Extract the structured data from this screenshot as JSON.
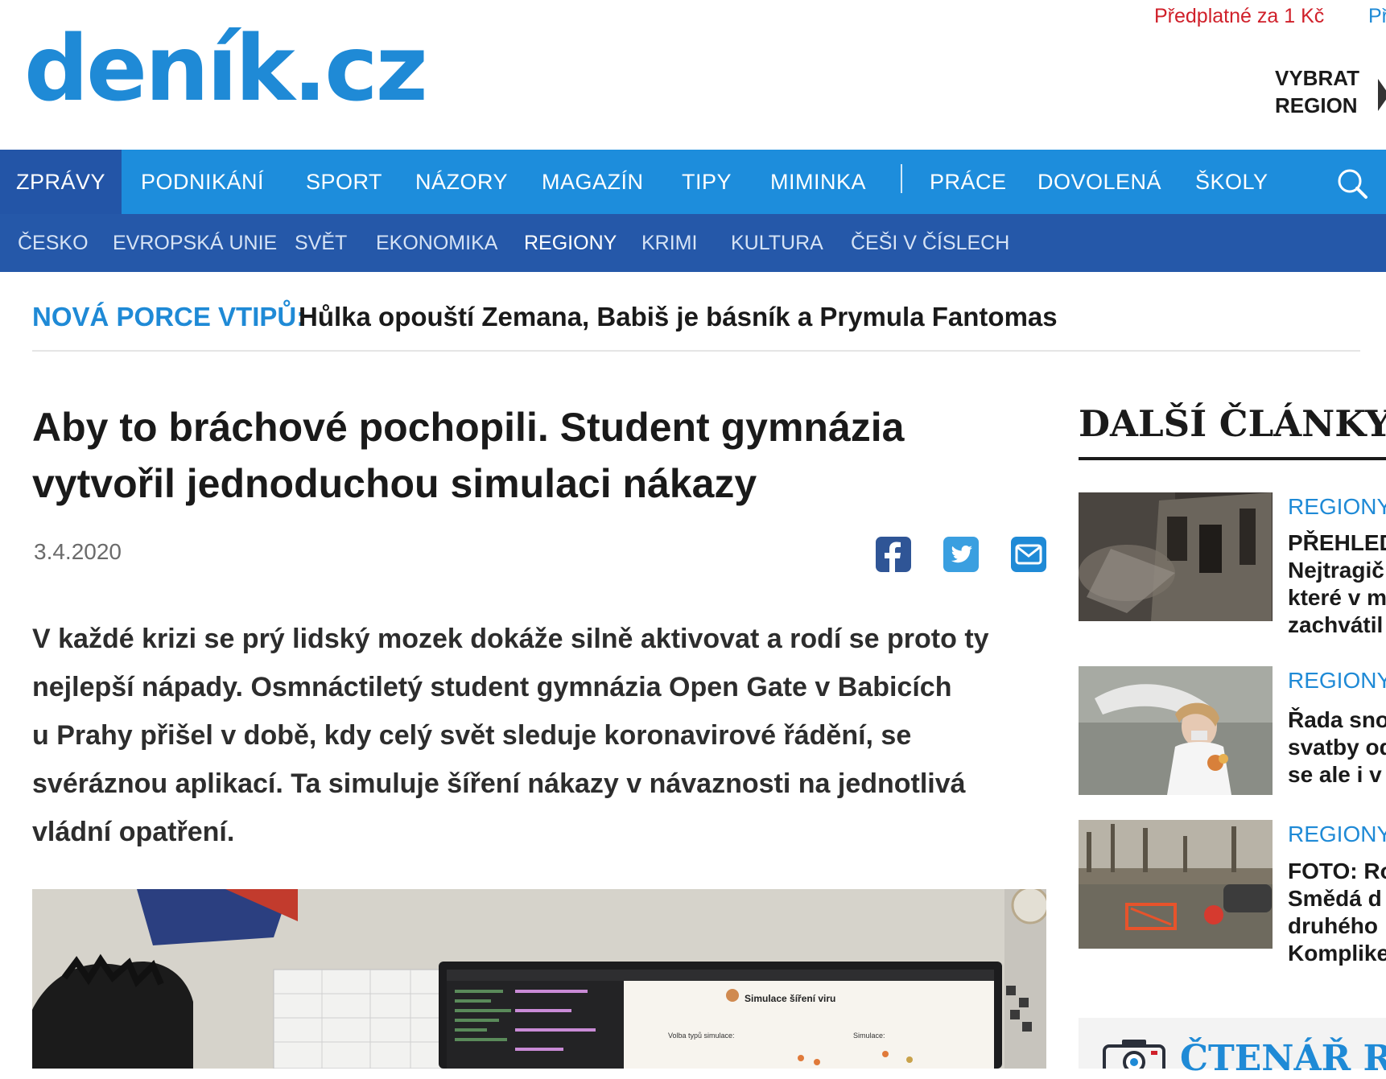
{
  "header": {
    "logo": "deník.cz",
    "subscribe": "Předplatné za 1 Kč",
    "subscribe_cut": "Př",
    "region_line1": "VYBRAT",
    "region_line2": "REGION"
  },
  "nav_primary": {
    "items": [
      "ZPRÁVY",
      "PODNIKÁNÍ",
      "SPORT",
      "NÁZORY",
      "MAGAZÍN",
      "TIPY",
      "MIMINKA",
      "PRÁCE",
      "DOVOLENÁ",
      "ŠKOLY"
    ],
    "active": "ZPRÁVY",
    "search_icon": "search-icon"
  },
  "nav_secondary": {
    "items": [
      "ČESKO",
      "EVROPSKÁ UNIE",
      "SVĚT",
      "EKONOMIKA",
      "REGIONY",
      "KRIMI",
      "KULTURA",
      "ČEŠI V ČÍSLECH"
    ],
    "active": "REGIONY"
  },
  "teaser": {
    "label": "NOVÁ PORCE VTIPŮ:",
    "text": "Hůlka opouští Zemana, Babiš je básník a Prymula Fantomas"
  },
  "article": {
    "headline_line1": "Aby to bráchové pochopili. Student gymnázia",
    "headline_line2": "vytvořil jednoduchou simulaci nákazy",
    "date": "3.4.2020",
    "share_icons": [
      "facebook-icon",
      "twitter-icon",
      "email-icon"
    ],
    "lead_lines": [
      "V každé krizi se prý lidský mozek dokáže silně aktivovat a rodí se proto ty",
      "nejlepší nápady. Osmnáctiletý student gymnázia Open Gate v Babicích",
      "u Prahy přišel v době, kdy celý svět sleduje koronavirové řádění, se",
      "svéráznou aplikací. Ta simuluje šíření nákazy v návaznosti na jednotlivá",
      "vládní opatření."
    ],
    "photo_screen_title": "Simulace šíření viru",
    "photo_screen_left_label": "Volba typů simulace:",
    "photo_screen_right_label": "Simulace:"
  },
  "sidebar": {
    "title": "DALŠÍ ČLÁNKY Z",
    "cards": [
      {
        "category": "REGIONY",
        "lines": [
          "PŘEHLED",
          "Nejtragič",
          "které v m",
          "zachvátil"
        ]
      },
      {
        "category": "REGIONY",
        "lines": [
          "Řada sno",
          "svatby od",
          "se ale i v"
        ]
      },
      {
        "category": "REGIONY",
        "lines": [
          "FOTO: Ro",
          "Smědá d",
          "druhého",
          "Komplike"
        ]
      }
    ],
    "reader_label": "ČTENÁŘ RE",
    "camera_icon": "camera-icon"
  }
}
